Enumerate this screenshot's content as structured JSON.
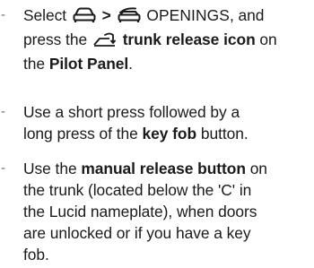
{
  "items": [
    {
      "lines": [
        {
          "p1": "Select",
          "icon_car": "car-front-icon",
          "p2": ">",
          "icon_car_open": "car-open-icon",
          "p3": "OPENINGS",
          "p4": ", and"
        },
        {
          "p1": "press the",
          "icon_trunk": "trunk-release-icon",
          "p2": "trunk release icon",
          "p3": " on"
        },
        {
          "p1": "the ",
          "p2": "Pilot Panel",
          "p3": "."
        }
      ]
    },
    {
      "lines": [
        {
          "p1": "Use a short press followed by a"
        },
        {
          "p1": "long press of the ",
          "p2": "key fob",
          "p3": " button."
        }
      ]
    },
    {
      "lines": [
        {
          "p1": "Use the ",
          "p2": "manual release button",
          "p3": " on"
        },
        {
          "p1": "the trunk (located below the 'C' in"
        },
        {
          "p1": "the Lucid nameplate), when doors"
        },
        {
          "p1": "are unlocked or if you have a key"
        },
        {
          "p1": "fob."
        }
      ]
    }
  ],
  "bullet_char": "-",
  "text_color": "#1a1a1a",
  "bullet_color": "#6b6b6b"
}
